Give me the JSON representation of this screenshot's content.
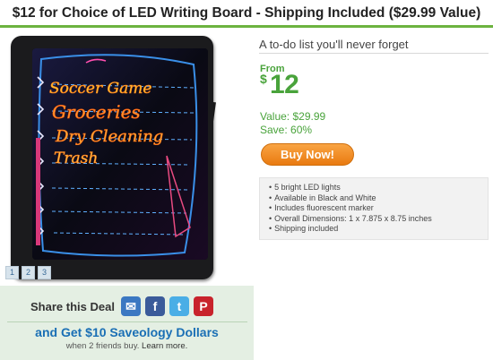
{
  "header": {
    "title": "$12 for Choice of LED Writing Board - Shipping Included ($29.99 Value)"
  },
  "photo": {
    "board_lines": [
      "Soccer Game",
      "Groceries",
      "Dry Cleaning",
      "Trash"
    ],
    "thumbnails": [
      "1",
      "2",
      "3"
    ]
  },
  "deal": {
    "tagline": "A to-do list you'll never forget",
    "from_label": "From",
    "currency": "$",
    "price": "12",
    "value": "Value: $29.99",
    "save": "Save: 60%",
    "buy_label": "Buy Now!",
    "features": [
      "5 bright LED lights",
      "Available in Black and White",
      "Includes fluorescent marker",
      "Overall Dimensions: 1 x 7.875 x 8.75 inches",
      "Shipping included"
    ]
  },
  "share": {
    "label": "Share this Deal",
    "icons": [
      "email-icon",
      "facebook-icon",
      "twitter-icon",
      "pinterest-icon"
    ],
    "promo": "and Get $10 Saveology Dollars",
    "promo_sub": "when 2 friends buy.",
    "learn_more": "Learn more."
  },
  "colors": {
    "green": "#49a33b",
    "orange": "#f08a1f",
    "blue": "#1a6fb5"
  }
}
